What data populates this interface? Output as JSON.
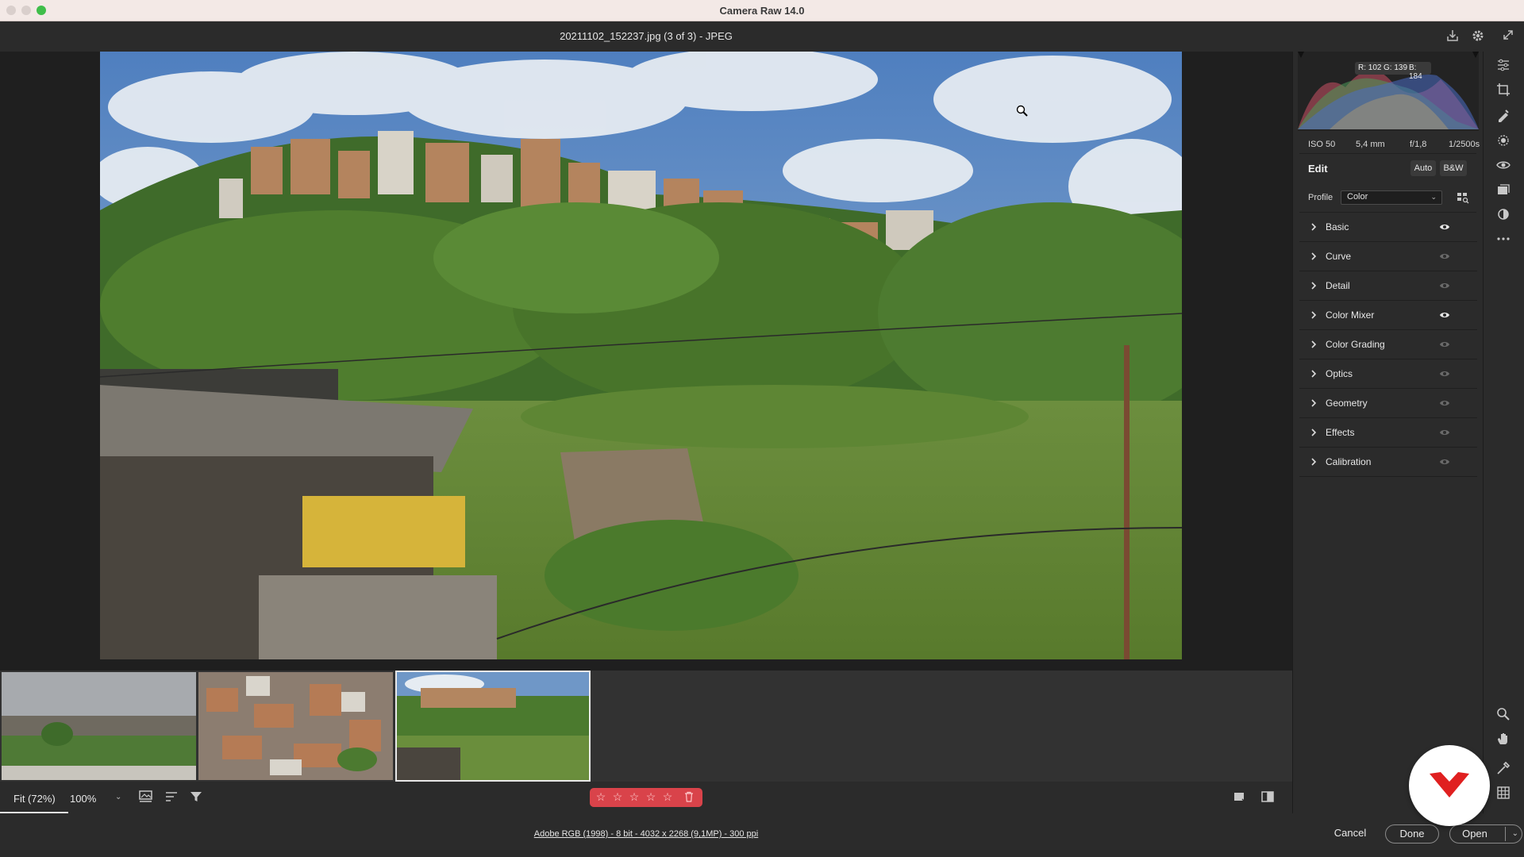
{
  "app": {
    "title": "Camera Raw 14.0"
  },
  "header": {
    "file_title": "20211102_152237.jpg (3 of 3)  -  JPEG"
  },
  "histogram": {
    "r_label": "R: 102",
    "g_label": "G: 139",
    "b_label": "B: 184"
  },
  "exif": {
    "iso": "ISO 50",
    "focal": "5,4 mm",
    "aperture": "f/1,8",
    "shutter": "1/2500s"
  },
  "edit": {
    "title": "Edit",
    "auto_label": "Auto",
    "bw_label": "B&W",
    "profile_label": "Profile",
    "profile_value": "Color",
    "sections": [
      {
        "label": "Basic",
        "eye": "active"
      },
      {
        "label": "Curve",
        "eye": "dim"
      },
      {
        "label": "Detail",
        "eye": "dim"
      },
      {
        "label": "Color Mixer",
        "eye": "active"
      },
      {
        "label": "Color Grading",
        "eye": "dim"
      },
      {
        "label": "Optics",
        "eye": "dim"
      },
      {
        "label": "Geometry",
        "eye": "dim"
      },
      {
        "label": "Effects",
        "eye": "dim"
      },
      {
        "label": "Calibration",
        "eye": "dim"
      }
    ]
  },
  "bottombar": {
    "zoom_fit": "Fit (72%)",
    "zoom_100": "100%"
  },
  "status": {
    "info": "Adobe RGB (1998) - 8 bit - 4032 x 2268 (9,1MP) - 300 ppi",
    "cancel": "Cancel",
    "done": "Done",
    "open": "Open"
  },
  "colors": {
    "rating_bg": "#d9434a",
    "accent_badge": "#e02020"
  }
}
